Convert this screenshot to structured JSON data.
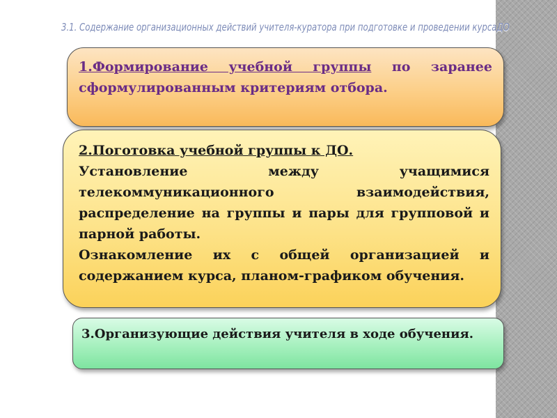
{
  "slide": {
    "title": "3.1. Содержание организационных действий учителя-куратора при подготовке и проведении курсаДО",
    "box1": {
      "underlined": "1.Формирование учебной группы",
      "rest": " по заранее сформулированным критериям отбора."
    },
    "box2": {
      "heading": "2.Поготовка учебной группы к ДО.",
      "para1": "Установление между учащимися телекоммуникационного взаимодействия, распределение на группы и пары для групповой и парной работы.",
      "para2": "Ознакомление их с общей организацией и содержанием курса, планом-графиком обучения."
    },
    "box3": {
      "text": "3.Организующие действия учителя в ходе обучения."
    }
  },
  "colors": {
    "box1_fill": "#fccf88",
    "box1_text": "#6a2c86",
    "box2_fill": "#fde38a",
    "box3_fill": "#a6f0be",
    "title_color": "#7e8cb8",
    "side_pattern": "#a9a9a9"
  }
}
